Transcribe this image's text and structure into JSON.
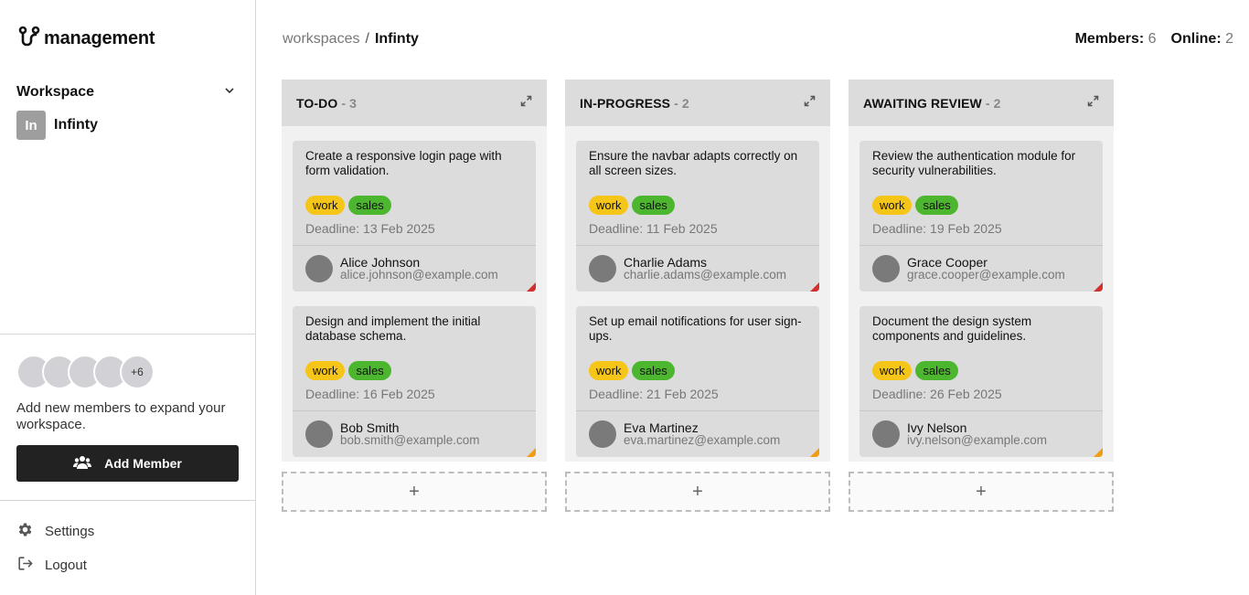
{
  "app": {
    "logo_text": "management"
  },
  "sidebar": {
    "workspace_label": "Workspace",
    "workspace_badge": "In",
    "workspace_name": "Infinty",
    "more_members": "+6",
    "add_text": "Add new members to expand your workspace.",
    "add_button": "Add Member",
    "settings": "Settings",
    "logout": "Logout"
  },
  "header": {
    "breadcrumb_root": "workspaces",
    "breadcrumb_sep": "/",
    "breadcrumb_current": "Infinty",
    "members_label": "Members:",
    "members_value": "6",
    "online_label": "Online:",
    "online_value": "2"
  },
  "columns": [
    {
      "title": "TO-DO",
      "count": "- 3",
      "cards": [
        {
          "desc": "Create a responsive login page with form validation.",
          "tag1": "work",
          "tag2": "sales",
          "deadline": "Deadline: 13 Feb 2025",
          "name": "Alice Johnson",
          "email": "alice.johnson@example.com",
          "priority": "red"
        },
        {
          "desc": "Design and implement the initial database schema.",
          "tag1": "work",
          "tag2": "sales",
          "deadline": "Deadline: 16 Feb 2025",
          "name": "Bob Smith",
          "email": "bob.smith@example.com",
          "priority": "orange"
        }
      ],
      "add": "+"
    },
    {
      "title": "IN-PROGRESS",
      "count": "- 2",
      "cards": [
        {
          "desc": "Ensure the navbar adapts correctly on all screen sizes.",
          "tag1": "work",
          "tag2": "sales",
          "deadline": "Deadline: 11 Feb 2025",
          "name": "Charlie Adams",
          "email": "charlie.adams@example.com",
          "priority": "red"
        },
        {
          "desc": "Set up email notifications for user sign-ups.",
          "tag1": "work",
          "tag2": "sales",
          "deadline": "Deadline: 21 Feb 2025",
          "name": "Eva Martinez",
          "email": "eva.martinez@example.com",
          "priority": "orange"
        }
      ],
      "add": "+"
    },
    {
      "title": "AWAITING REVIEW",
      "count": "- 2",
      "cards": [
        {
          "desc": "Review the authentication module for security vulnerabilities.",
          "tag1": "work",
          "tag2": "sales",
          "deadline": "Deadline: 19 Feb 2025",
          "name": "Grace Cooper",
          "email": "grace.cooper@example.com",
          "priority": "red"
        },
        {
          "desc": "Document the design system components and guidelines.",
          "tag1": "work",
          "tag2": "sales",
          "deadline": "Deadline: 26 Feb 2025",
          "name": "Ivy Nelson",
          "email": "ivy.nelson@example.com",
          "priority": "orange"
        }
      ],
      "add": "+"
    }
  ],
  "colors": {
    "tag_work": "#f5c518",
    "tag_sales": "#4cb72e",
    "priority_red": "#d32f2f",
    "priority_orange": "#f29c11"
  }
}
